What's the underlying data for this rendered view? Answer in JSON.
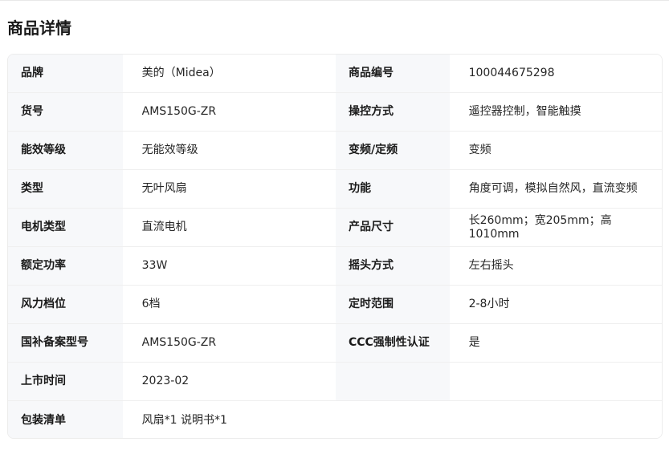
{
  "section_title": "商品详情",
  "rows": [
    {
      "l1": "品牌",
      "v1": "美的（Midea）",
      "l2": "商品编号",
      "v2": "100044675298"
    },
    {
      "l1": "货号",
      "v1": "AMS150G-ZR",
      "l2": "操控方式",
      "v2": "遥控器控制，智能触摸"
    },
    {
      "l1": "能效等级",
      "v1": "无能效等级",
      "l2": "变频/定频",
      "v2": "变频"
    },
    {
      "l1": "类型",
      "v1": "无叶风扇",
      "l2": "功能",
      "v2": "角度可调，模拟自然风，直流变频"
    },
    {
      "l1": "电机类型",
      "v1": "直流电机",
      "l2": "产品尺寸",
      "v2": "长260mm；宽205mm；高1010mm"
    },
    {
      "l1": "额定功率",
      "v1": "33W",
      "l2": "摇头方式",
      "v2": "左右摇头"
    },
    {
      "l1": "风力档位",
      "v1": "6档",
      "l2": "定时范围",
      "v2": "2-8小时"
    },
    {
      "l1": "国补备案型号",
      "v1": "AMS150G-ZR",
      "l2": "CCC强制性认证",
      "v2": "是"
    },
    {
      "l1": "上市时间",
      "v1": "2023-02",
      "l2": "",
      "v2": ""
    }
  ],
  "last_row": {
    "label": "包装清单",
    "value": "风扇*1 说明书*1"
  }
}
